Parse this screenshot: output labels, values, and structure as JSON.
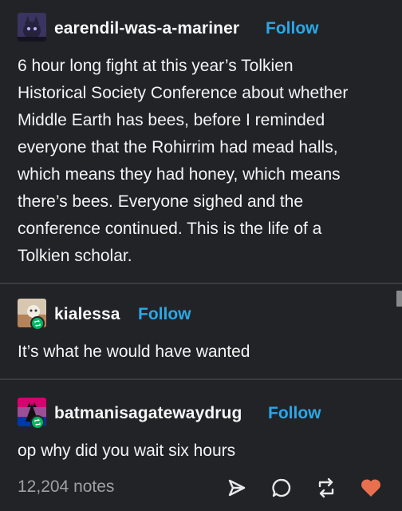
{
  "posts": [
    {
      "username": "earendil-was-a-mariner",
      "follow_label": "Follow",
      "text_lines": [
        "6 hour long fight at this year’s Tolkien",
        "Historical Society Conference about whether",
        "Middle Earth has bees, before I reminded",
        "everyone that the Rohirrim had mead halls,",
        "which means they had honey, which means",
        "there’s bees. Everyone sighed and the",
        "conference continued. This is the life of a",
        "Tolkien scholar."
      ]
    },
    {
      "username": "kialessa",
      "follow_label": "Follow",
      "text_lines": [
        "It’s what he would have wanted"
      ]
    },
    {
      "username": "batmanisagatewaydrug",
      "follow_label": "Follow",
      "text_lines": [
        "op why did you wait six hours"
      ]
    }
  ],
  "footer": {
    "notes": "12,204 notes",
    "actions": [
      "share-icon",
      "comment-icon",
      "reblog-icon",
      "heart-icon"
    ]
  },
  "colors": {
    "background": "#222327",
    "follow": "#2aa8e8",
    "reblog_badge": "#01b65f",
    "heart": "#e8704f",
    "notes": "#9ea0a4"
  }
}
